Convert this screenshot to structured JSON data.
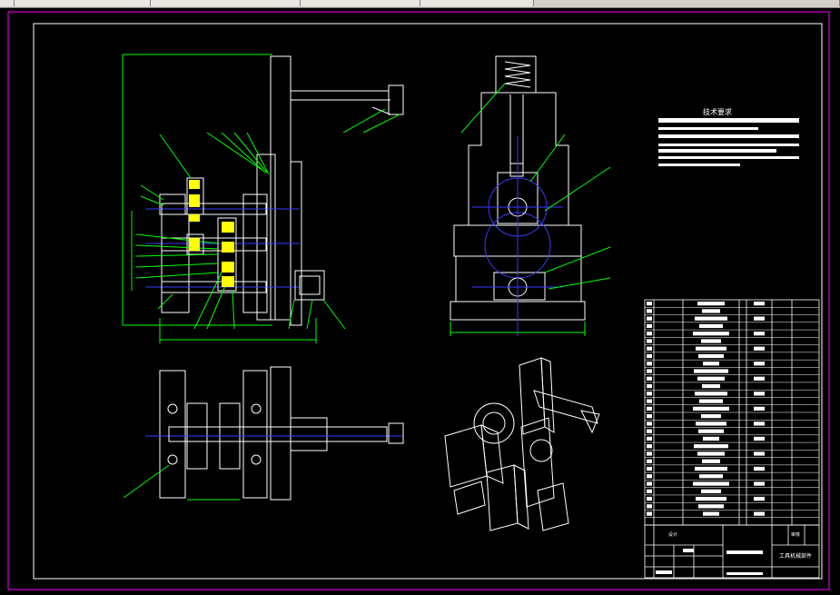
{
  "window": {
    "tabs": [
      "",
      "",
      "",
      "",
      "",
      ""
    ]
  },
  "notes": {
    "title": "技术要求"
  },
  "titleblock": {
    "name": "工具机械部件",
    "designer": "设计",
    "checker": "审核"
  },
  "colors": {
    "background": "#000000",
    "frame": "#ffffff",
    "border": "#ff00ff",
    "line": "#ffffff",
    "center": "#3a3aff",
    "dimension": "#00ff00",
    "highlight": "#ffff00"
  }
}
